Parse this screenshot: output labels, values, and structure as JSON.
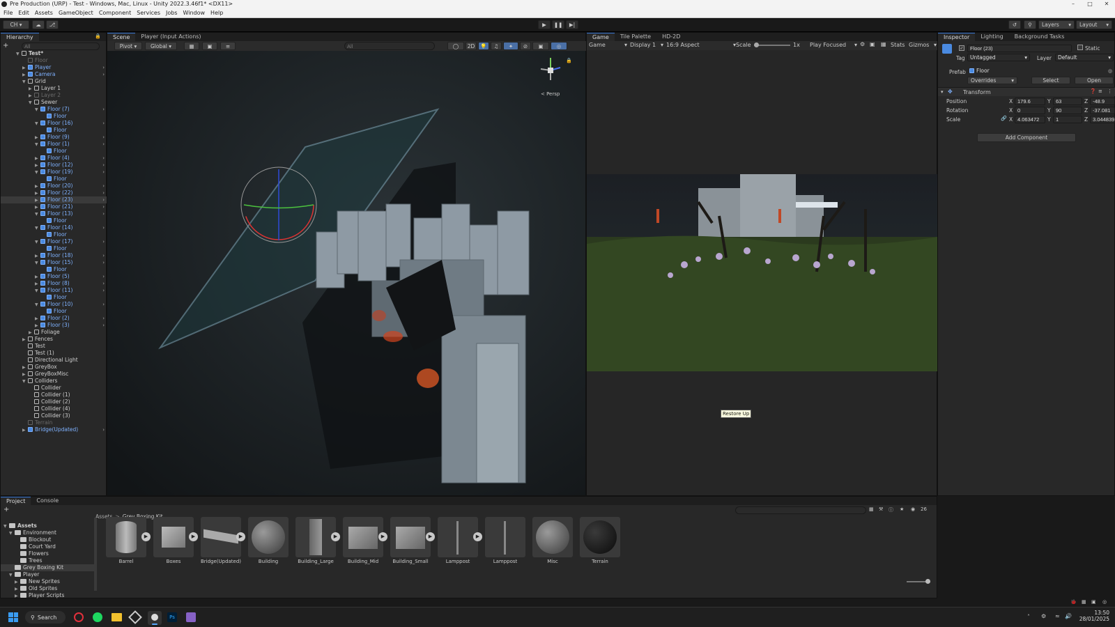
{
  "window": {
    "title": "Pre Production (URP) - Test - Windows, Mac, Linux - Unity 2022.3.46f1* <DX11>"
  },
  "menu": [
    "File",
    "Edit",
    "Assets",
    "GameObject",
    "Component",
    "Services",
    "Jobs",
    "Window",
    "Help"
  ],
  "toolbar": {
    "account": "CH",
    "layers": "Layers",
    "layout": "Layout"
  },
  "hierarchy": {
    "tab": "Hierarchy",
    "search_placeholder": "All",
    "rows": [
      {
        "label": "Test*",
        "indent": 0,
        "type": "scene",
        "expand": "down"
      },
      {
        "label": "Floor",
        "indent": 1,
        "type": "go",
        "dim": true
      },
      {
        "label": "Player",
        "indent": 1,
        "type": "prefab",
        "expand": "right"
      },
      {
        "label": "Camera",
        "indent": 1,
        "type": "prefab",
        "expand": "right"
      },
      {
        "label": "Grid",
        "indent": 1,
        "type": "go",
        "expand": "down"
      },
      {
        "label": "Layer 1",
        "indent": 2,
        "type": "go",
        "expand": "right"
      },
      {
        "label": "Layer 2",
        "indent": 2,
        "type": "go",
        "dim": true,
        "expand": "right"
      },
      {
        "label": "Sewer",
        "indent": 2,
        "type": "go",
        "expand": "down"
      },
      {
        "label": "Floor (7)",
        "indent": 3,
        "type": "prefab",
        "expand": "down"
      },
      {
        "label": "Floor",
        "indent": 4,
        "type": "prefab"
      },
      {
        "label": "Floor (16)",
        "indent": 3,
        "type": "prefab",
        "expand": "down"
      },
      {
        "label": "Floor",
        "indent": 4,
        "type": "prefab"
      },
      {
        "label": "Floor (9)",
        "indent": 3,
        "type": "prefab",
        "expand": "right"
      },
      {
        "label": "Floor (1)",
        "indent": 3,
        "type": "prefab",
        "expand": "down"
      },
      {
        "label": "Floor",
        "indent": 4,
        "type": "prefab"
      },
      {
        "label": "Floor (4)",
        "indent": 3,
        "type": "prefab",
        "expand": "right"
      },
      {
        "label": "Floor (12)",
        "indent": 3,
        "type": "prefab",
        "expand": "right"
      },
      {
        "label": "Floor (19)",
        "indent": 3,
        "type": "prefab",
        "expand": "down"
      },
      {
        "label": "Floor",
        "indent": 4,
        "type": "prefab"
      },
      {
        "label": "Floor (20)",
        "indent": 3,
        "type": "prefab",
        "expand": "right"
      },
      {
        "label": "Floor (22)",
        "indent": 3,
        "type": "prefab",
        "expand": "right"
      },
      {
        "label": "Floor (23)",
        "indent": 3,
        "type": "prefab",
        "expand": "right",
        "selected": true
      },
      {
        "label": "Floor (21)",
        "indent": 3,
        "type": "prefab",
        "expand": "right"
      },
      {
        "label": "Floor (13)",
        "indent": 3,
        "type": "prefab",
        "expand": "down"
      },
      {
        "label": "Floor",
        "indent": 4,
        "type": "prefab"
      },
      {
        "label": "Floor (14)",
        "indent": 3,
        "type": "prefab",
        "expand": "down"
      },
      {
        "label": "Floor",
        "indent": 4,
        "type": "prefab"
      },
      {
        "label": "Floor (17)",
        "indent": 3,
        "type": "prefab",
        "expand": "down"
      },
      {
        "label": "Floor",
        "indent": 4,
        "type": "prefab"
      },
      {
        "label": "Floor (18)",
        "indent": 3,
        "type": "prefab",
        "expand": "right"
      },
      {
        "label": "Floor (15)",
        "indent": 3,
        "type": "prefab",
        "expand": "down"
      },
      {
        "label": "Floor",
        "indent": 4,
        "type": "prefab"
      },
      {
        "label": "Floor (5)",
        "indent": 3,
        "type": "prefab",
        "expand": "right"
      },
      {
        "label": "Floor (8)",
        "indent": 3,
        "type": "prefab",
        "expand": "right"
      },
      {
        "label": "Floor (11)",
        "indent": 3,
        "type": "prefab",
        "expand": "down"
      },
      {
        "label": "Floor",
        "indent": 4,
        "type": "prefab"
      },
      {
        "label": "Floor (10)",
        "indent": 3,
        "type": "prefab",
        "expand": "down"
      },
      {
        "label": "Floor",
        "indent": 4,
        "type": "prefab"
      },
      {
        "label": "Floor (2)",
        "indent": 3,
        "type": "prefab",
        "expand": "right"
      },
      {
        "label": "Floor (3)",
        "indent": 3,
        "type": "prefab",
        "expand": "right"
      },
      {
        "label": "Foliage",
        "indent": 2,
        "type": "go",
        "expand": "right"
      },
      {
        "label": "Fences",
        "indent": 1,
        "type": "go",
        "expand": "right"
      },
      {
        "label": "Test",
        "indent": 1,
        "type": "go"
      },
      {
        "label": "Test (1)",
        "indent": 1,
        "type": "go"
      },
      {
        "label": "Directional Light",
        "indent": 1,
        "type": "go"
      },
      {
        "label": "GreyBox",
        "indent": 1,
        "type": "go",
        "expand": "right"
      },
      {
        "label": "GreyBoxMisc",
        "indent": 1,
        "type": "go",
        "expand": "right"
      },
      {
        "label": "Colliders",
        "indent": 1,
        "type": "go",
        "expand": "down"
      },
      {
        "label": "Collider",
        "indent": 2,
        "type": "go"
      },
      {
        "label": "Collider (1)",
        "indent": 2,
        "type": "go"
      },
      {
        "label": "Collider (2)",
        "indent": 2,
        "type": "go"
      },
      {
        "label": "Collider (4)",
        "indent": 2,
        "type": "go"
      },
      {
        "label": "Collider (3)",
        "indent": 2,
        "type": "go"
      },
      {
        "label": "Terrain",
        "indent": 1,
        "type": "go",
        "dim": true
      },
      {
        "label": "Bridge(Updated)",
        "indent": 1,
        "type": "prefab",
        "expand": "right"
      }
    ]
  },
  "scene": {
    "tabs": [
      "Scene",
      "Player (Input Actions)"
    ],
    "pivot": "Pivot",
    "global": "Global",
    "mode2d": "2D",
    "search_placeholder": "All",
    "persp": "< Persp"
  },
  "game": {
    "tabs": [
      "Game",
      "Tile Palette",
      "HD-2D"
    ],
    "mode": "Game",
    "display": "Display 1",
    "aspect": "16:9 Aspect",
    "scale_label": "Scale",
    "scale_value": "1x",
    "play_focused": "Play Focused",
    "stats": "Stats",
    "gizmos": "Gizmos",
    "tooltip": "Restore Up"
  },
  "inspector": {
    "tabs": [
      "Inspector",
      "Lighting",
      "Background Tasks"
    ],
    "object_name": "Floor (23)",
    "static_label": "Static",
    "tag_label": "Tag",
    "tag_value": "Untagged",
    "layer_label": "Layer",
    "layer_value": "Default",
    "prefab_label": "Prefab",
    "prefab_value": "Floor",
    "overrides": "Overrides",
    "select": "Select",
    "open": "Open",
    "transform_title": "Transform",
    "position_label": "Position",
    "rotation_label": "Rotation",
    "scale_label": "Scale",
    "position": {
      "x": "179.6",
      "y": "63",
      "z": "-48.9"
    },
    "rotation": {
      "x": "0",
      "y": "90",
      "z": "-37.081"
    },
    "scale": {
      "x": "4.063472",
      "y": "1",
      "z": "3.044839"
    },
    "add_component": "Add Component"
  },
  "project": {
    "tabs": [
      "Project",
      "Console"
    ],
    "breadcrumb": [
      "Assets",
      "Grey Boxing Kit"
    ],
    "count": "26",
    "tree": [
      {
        "label": "Assets",
        "indent": 0,
        "expand": "down",
        "bold": true
      },
      {
        "label": "Environment",
        "indent": 1,
        "expand": "down"
      },
      {
        "label": "Blockout",
        "indent": 2
      },
      {
        "label": "Court Yard",
        "indent": 2
      },
      {
        "label": "Flowers",
        "indent": 2
      },
      {
        "label": "Trees",
        "indent": 2
      },
      {
        "label": "Grey Boxing Kit",
        "indent": 1,
        "selected": true
      },
      {
        "label": "Player",
        "indent": 1,
        "expand": "down"
      },
      {
        "label": "New Sprites",
        "indent": 2,
        "expand": "right"
      },
      {
        "label": "Old Sprites",
        "indent": 2,
        "expand": "right"
      },
      {
        "label": "Player Scripts",
        "indent": 2,
        "expand": "right"
      }
    ],
    "assets": [
      {
        "label": "Barrel",
        "kind": "barrel",
        "arrow": true
      },
      {
        "label": "Boxes",
        "kind": "boxes",
        "arrow": true
      },
      {
        "label": "Bridge(Updated)",
        "kind": "bridge",
        "arrow": true
      },
      {
        "label": "Building",
        "kind": "sphere",
        "arrow": false
      },
      {
        "label": "Building_Large",
        "kind": "tall",
        "arrow": true
      },
      {
        "label": "Building_Mid",
        "kind": "box",
        "arrow": true
      },
      {
        "label": "Building_Small",
        "kind": "box",
        "arrow": true
      },
      {
        "label": "Lamppost",
        "kind": "lamp",
        "arrow": true
      },
      {
        "label": "Lamppost",
        "kind": "lamp",
        "arrow": false
      },
      {
        "label": "Misc",
        "kind": "sphere",
        "arrow": false
      },
      {
        "label": "Terrain",
        "kind": "dark",
        "arrow": false
      }
    ]
  },
  "taskbar": {
    "search": "Search",
    "time": "13:50",
    "date": "28/01/2025"
  },
  "colors": {
    "accent": "#3a79d6",
    "prefab": "#7fb2ff",
    "panel": "#282828"
  }
}
